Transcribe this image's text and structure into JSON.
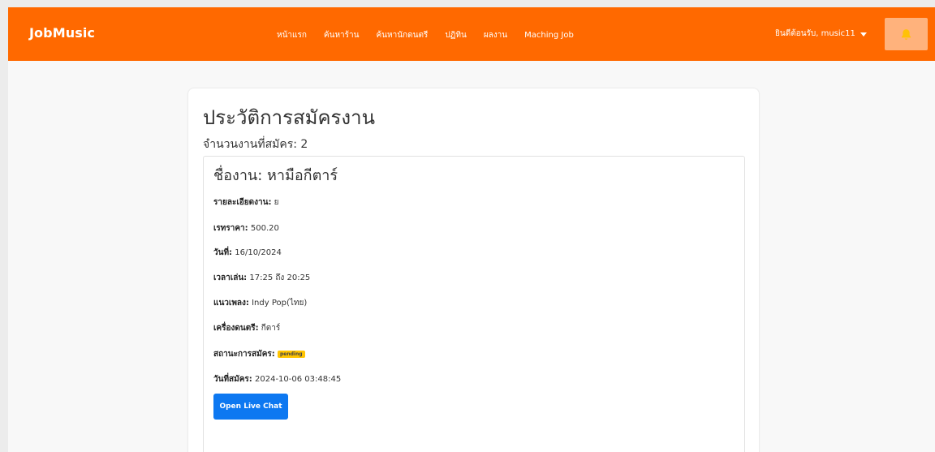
{
  "brand": {
    "name": "JobMusic"
  },
  "nav": {
    "items": [
      {
        "label": "หน้าแรก"
      },
      {
        "label": "ค้นหาร้าน"
      },
      {
        "label": "ค้นหานักดนตรี"
      },
      {
        "label": "ปฏิทิน"
      },
      {
        "label": "ผลงาน"
      },
      {
        "label": "Maching Job"
      }
    ],
    "user_greeting": "ยินดีต้อนรับ, music11",
    "notification_icon": "bell-icon",
    "colors": {
      "navbar": "#ff6900",
      "bell_button": "#ffb27c"
    }
  },
  "history": {
    "title": "ประวัติการสมัครงาน",
    "count_label": "จำนวนงานที่สมัคร:",
    "count_value": "2"
  },
  "job": {
    "title_label": "ชื่องาน:",
    "title_value": "หามือกีตาร์",
    "details": [
      {
        "label": "รายละเอียดงาน:",
        "value": "ย"
      },
      {
        "label": "เรทราคา:",
        "value": "500.20"
      },
      {
        "label": "วันที่:",
        "value": "16/10/2024"
      },
      {
        "label": "เวลาเล่น:",
        "value": "17:25 ถึง 20:25"
      },
      {
        "label": "แนวเพลง:",
        "value": "Indy Pop(ไทย)"
      },
      {
        "label": "เครื่องดนตรี:",
        "value": "กีตาร์"
      },
      {
        "label": "สถานะการสมัคร:",
        "badge": "pending"
      },
      {
        "label": "วันที่สมัคร:",
        "value": "2024-10-06 03:48:45"
      }
    ],
    "chat_button_label": "Open Live Chat",
    "colors": {
      "chat_button": "#0d78f1",
      "pending_badge": "#ffc400"
    }
  }
}
